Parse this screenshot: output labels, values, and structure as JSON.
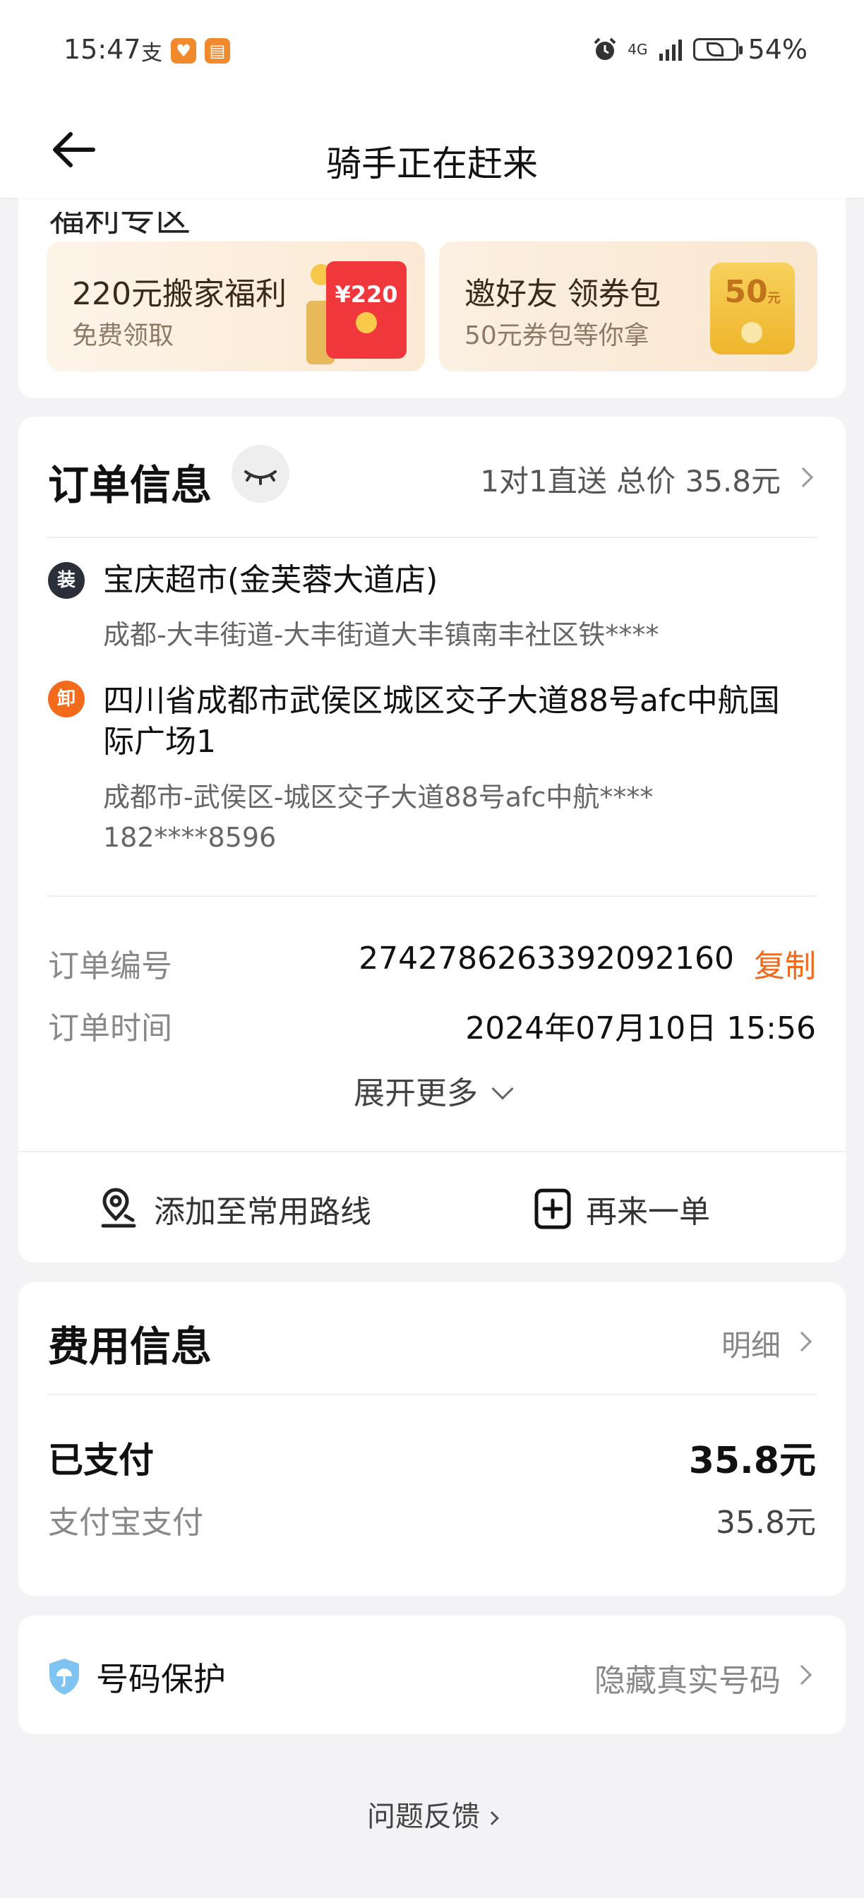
{
  "status_bar": {
    "time": "15:47",
    "alipay_icon_text": "支",
    "network": "4G",
    "battery_percent": "54%"
  },
  "header": {
    "title": "骑手正在赶来"
  },
  "welfare": {
    "section_title": "福利专区",
    "promos": [
      {
        "title": "220元搬家福利",
        "subtitle": "免费领取",
        "badge": "¥220"
      },
      {
        "title": "邀好友 领券包",
        "subtitle": "50元券包等你拿",
        "badge": "50",
        "badge_unit": "元"
      }
    ]
  },
  "order": {
    "title": "订单信息",
    "summary": "1对1直送 总价 35.8元",
    "pickup": {
      "badge": "装",
      "name": "宝庆超市(金芙蓉大道店)",
      "address": "成都-大丰街道-大丰街道大丰镇南丰社区铁****"
    },
    "dropoff": {
      "badge": "卸",
      "name": "四川省成都市武侯区城区交子大道88号afc中航国际广场1",
      "address": "成都市-武侯区-城区交子大道88号afc中航****",
      "phone": "182****8596"
    },
    "number_label": "订单编号",
    "number_value": "2742786263392092160",
    "copy_label": "复制",
    "time_label": "订单时间",
    "time_value": "2024年07月10日 15:56",
    "expand_label": "展开更多",
    "actions": {
      "add_route": "添加至常用路线",
      "reorder": "再来一单"
    }
  },
  "fee": {
    "title": "费用信息",
    "detail_label": "明细",
    "paid_label": "已支付",
    "paid_value": "35.8元",
    "method_label": "支付宝支付",
    "method_value": "35.8元"
  },
  "protection": {
    "label": "号码保护",
    "value": "隐藏真实号码"
  },
  "feedback_label": "问题反馈",
  "colors": {
    "accent_orange": "#ee6a1e",
    "background": "#f3f3f5",
    "card": "#ffffff"
  }
}
